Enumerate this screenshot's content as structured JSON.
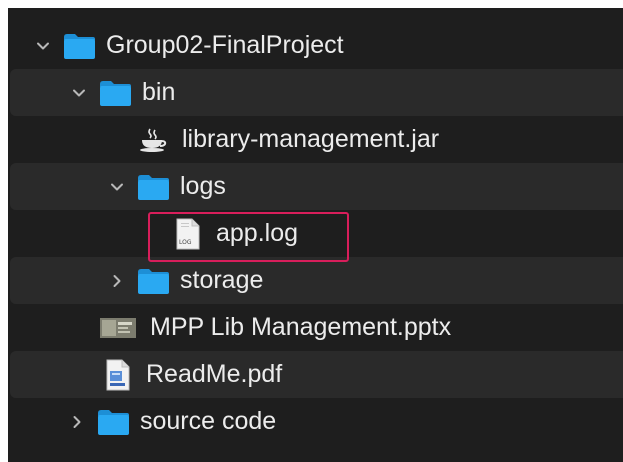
{
  "colors": {
    "background": "#1e1e1e",
    "row_alt": "#2a2a2a",
    "text": "#ececec",
    "folder": "#2aa9f2",
    "highlight_border": "#d81e5b"
  },
  "tree": {
    "root": {
      "label": "Group02-FinalProject",
      "icon": "folder-icon",
      "expanded": true
    },
    "bin": {
      "label": "bin",
      "icon": "folder-icon",
      "expanded": true
    },
    "jar": {
      "label": "library-management.jar",
      "icon": "java-coffee-cup-icon"
    },
    "logs": {
      "label": "logs",
      "icon": "folder-icon",
      "expanded": true
    },
    "applog": {
      "label": "app.log",
      "icon": "log-file-icon",
      "icon_text": "LOG",
      "highlighted": true
    },
    "storage": {
      "label": "storage",
      "icon": "folder-icon",
      "expanded": false
    },
    "pptx": {
      "label": "MPP Lib Management.pptx",
      "icon": "pptx-thumbnail-icon"
    },
    "readme": {
      "label": "ReadMe.pdf",
      "icon": "pdf-file-icon"
    },
    "source": {
      "label": "source code",
      "icon": "folder-icon",
      "expanded": false
    }
  }
}
